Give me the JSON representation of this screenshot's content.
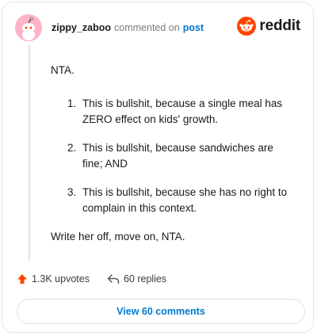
{
  "comment": {
    "username": "zippy_zaboo",
    "action": "commented on",
    "post_link": "post",
    "brand": "reddit",
    "body": {
      "intro": "NTA.",
      "items": [
        "This is bullshit, because a single meal has ZERO effect on kids' growth.",
        "This is bullshit, because sandwiches are fine; AND",
        "This is bullshit, because she has no right to complain in this context."
      ],
      "closing": "Write her off, move on, NTA."
    },
    "stats": {
      "upvotes": "1.3K upvotes",
      "replies": "60 replies"
    },
    "view_button": "View 60 comments"
  },
  "colors": {
    "accent": "#0079d3",
    "brand": "#ff4500",
    "upvote": "#ff4500",
    "avatar_bg": "#ffb3c7"
  },
  "icons": {
    "avatar": "snoo-avatar-icon",
    "logo": "reddit-snoo-icon",
    "upvote": "upvote-arrow-icon",
    "reply": "reply-arrow-icon"
  }
}
